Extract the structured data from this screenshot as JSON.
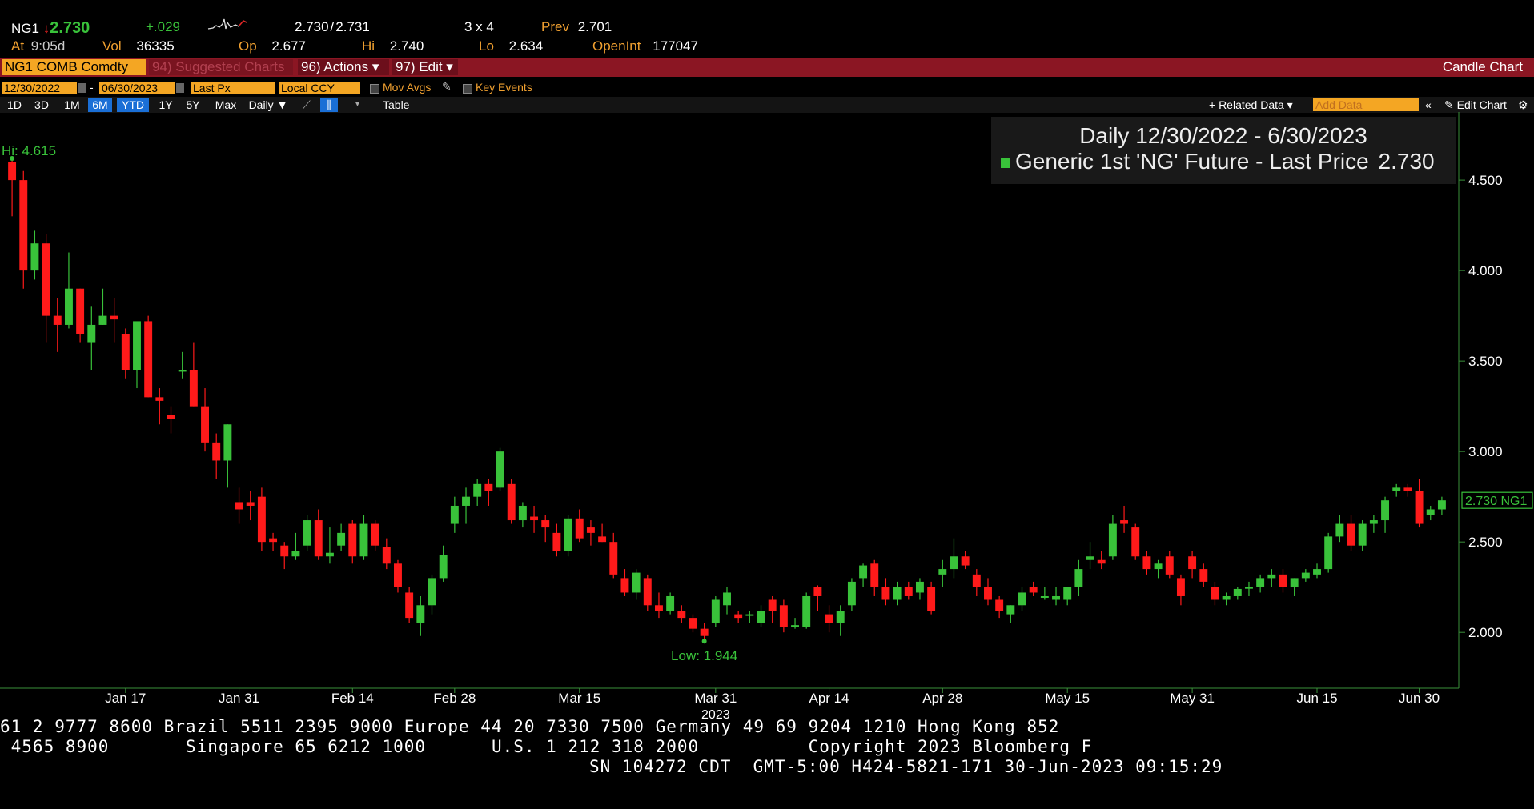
{
  "quote": {
    "ticker": "NG1",
    "arrow": "↓",
    "last": "2.730",
    "change": "+.029",
    "bidask_bid": "2.730",
    "bidask_sep": "/",
    "bidask_ask": "2.731",
    "size": "3 x 4",
    "prev_label": "Prev",
    "prev": "2.701",
    "at_label": "At",
    "at_time": "9:05d",
    "vol_label": "Vol",
    "vol": "36335",
    "op_label": "Op",
    "op": "2.677",
    "hi_label": "Hi",
    "hi": "2.740",
    "lo_label": "Lo",
    "lo": "2.634",
    "openint_label": "OpenInt",
    "openint": "177047"
  },
  "menubar": {
    "security": "NG1 COMB Comdty",
    "suggested": "94) Suggested Charts",
    "actions": "96) Actions ▾",
    "edit": "97) Edit ▾",
    "chart_type": "Candle Chart"
  },
  "options": {
    "start_date": "12/30/2022",
    "dash": "-",
    "end_date": "06/30/2023",
    "field": "Last Px",
    "currency": "Local CCY",
    "mov_avgs": "Mov Avgs",
    "key_events": "Key Events"
  },
  "toolbar": {
    "periods": [
      "1D",
      "3D",
      "1M",
      "6M",
      "YTD",
      "1Y",
      "5Y",
      "Max"
    ],
    "selected": [
      "6M",
      "YTD"
    ],
    "frequency": "Daily ▼",
    "table": "Table",
    "related": "+ Related Data ▾",
    "add_data": "Add Data",
    "edit_chart": "Edit Chart"
  },
  "legend": {
    "title": "Daily 12/30/2022 - 6/30/2023",
    "series": "Generic 1st 'NG' Future - Last Price",
    "series_value": "2.730"
  },
  "colors": {
    "up": "#39c23a",
    "down": "#ff1a1a",
    "axis": "#3a8f3a",
    "menubar": "#8b1623",
    "accent": "#f4a623"
  },
  "chart_data": {
    "type": "candlestick",
    "title": "Daily 12/30/2022 - 6/30/2023",
    "year_label": "2023",
    "ylim": [
      1.7,
      4.85
    ],
    "yticks": [
      "2.000",
      "2.500",
      "3.000",
      "3.500",
      "4.000",
      "4.500"
    ],
    "xticks": [
      {
        "label": "Jan 17",
        "i": 10
      },
      {
        "label": "Jan 31",
        "i": 20
      },
      {
        "label": "Feb 14",
        "i": 30
      },
      {
        "label": "Feb 28",
        "i": 39
      },
      {
        "label": "Mar 15",
        "i": 50
      },
      {
        "label": "Mar 31",
        "i": 62
      },
      {
        "label": "Apr 14",
        "i": 72
      },
      {
        "label": "Apr 28",
        "i": 82
      },
      {
        "label": "May 15",
        "i": 93
      },
      {
        "label": "May 31",
        "i": 104
      },
      {
        "label": "Jun 15",
        "i": 115
      },
      {
        "label": "Jun 30",
        "i": 124
      }
    ],
    "hi_label": "Hi: 4.615",
    "low_label": "Low: 1.944",
    "last_label": "2.730 NG1",
    "last_value": 2.73,
    "candles": [
      [
        4.6,
        4.62,
        4.3,
        4.5
      ],
      [
        4.5,
        4.55,
        3.9,
        4.0
      ],
      [
        4.0,
        4.22,
        3.95,
        4.15
      ],
      [
        4.15,
        4.2,
        3.6,
        3.75
      ],
      [
        3.75,
        3.85,
        3.55,
        3.7
      ],
      [
        3.7,
        4.1,
        3.68,
        3.9
      ],
      [
        3.9,
        3.9,
        3.6,
        3.65
      ],
      [
        3.6,
        3.8,
        3.45,
        3.7
      ],
      [
        3.7,
        3.9,
        3.7,
        3.75
      ],
      [
        3.75,
        3.85,
        3.6,
        3.73
      ],
      [
        3.65,
        3.68,
        3.4,
        3.45
      ],
      [
        3.45,
        3.5,
        3.35,
        3.72
      ],
      [
        3.72,
        3.75,
        3.3,
        3.3
      ],
      [
        3.3,
        3.35,
        3.15,
        3.28
      ],
      [
        3.2,
        3.25,
        3.1,
        3.18
      ],
      [
        3.45,
        3.55,
        3.4,
        3.45
      ],
      [
        3.45,
        3.6,
        3.25,
        3.25
      ],
      [
        3.25,
        3.35,
        3.0,
        3.05
      ],
      [
        3.05,
        3.1,
        2.85,
        2.95
      ],
      [
        2.95,
        3.15,
        2.8,
        3.15
      ],
      [
        2.72,
        2.8,
        2.6,
        2.68
      ],
      [
        2.72,
        2.78,
        2.62,
        2.7
      ],
      [
        2.75,
        2.8,
        2.45,
        2.5
      ],
      [
        2.52,
        2.55,
        2.45,
        2.5
      ],
      [
        2.48,
        2.5,
        2.35,
        2.42
      ],
      [
        2.42,
        2.55,
        2.4,
        2.45
      ],
      [
        2.48,
        2.65,
        2.45,
        2.62
      ],
      [
        2.62,
        2.68,
        2.4,
        2.42
      ],
      [
        2.42,
        2.58,
        2.38,
        2.44
      ],
      [
        2.48,
        2.6,
        2.45,
        2.55
      ],
      [
        2.6,
        2.62,
        2.38,
        2.42
      ],
      [
        2.42,
        2.65,
        2.4,
        2.6
      ],
      [
        2.6,
        2.62,
        2.45,
        2.48
      ],
      [
        2.47,
        2.52,
        2.35,
        2.38
      ],
      [
        2.38,
        2.4,
        2.22,
        2.25
      ],
      [
        2.22,
        2.25,
        2.05,
        2.08
      ],
      [
        2.05,
        2.2,
        1.98,
        2.15
      ],
      [
        2.15,
        2.32,
        2.1,
        2.3
      ],
      [
        2.3,
        2.48,
        2.28,
        2.43
      ],
      [
        2.6,
        2.75,
        2.55,
        2.7
      ],
      [
        2.7,
        2.8,
        2.6,
        2.75
      ],
      [
        2.75,
        2.85,
        2.7,
        2.82
      ],
      [
        2.82,
        2.85,
        2.7,
        2.78
      ],
      [
        2.8,
        3.02,
        2.78,
        3.0
      ],
      [
        2.82,
        2.85,
        2.6,
        2.62
      ],
      [
        2.62,
        2.72,
        2.58,
        2.7
      ],
      [
        2.64,
        2.7,
        2.55,
        2.62
      ],
      [
        2.62,
        2.65,
        2.5,
        2.58
      ],
      [
        2.55,
        2.6,
        2.42,
        2.45
      ],
      [
        2.45,
        2.65,
        2.42,
        2.63
      ],
      [
        2.63,
        2.68,
        2.5,
        2.52
      ],
      [
        2.58,
        2.62,
        2.48,
        2.55
      ],
      [
        2.53,
        2.6,
        2.5,
        2.5
      ],
      [
        2.5,
        2.55,
        2.3,
        2.32
      ],
      [
        2.3,
        2.35,
        2.2,
        2.22
      ],
      [
        2.22,
        2.35,
        2.18,
        2.33
      ],
      [
        2.3,
        2.32,
        2.12,
        2.15
      ],
      [
        2.15,
        2.22,
        2.08,
        2.12
      ],
      [
        2.12,
        2.22,
        2.1,
        2.2
      ],
      [
        2.12,
        2.15,
        2.05,
        2.08
      ],
      [
        2.08,
        2.1,
        2.0,
        2.02
      ],
      [
        2.02,
        2.05,
        1.96,
        1.98
      ],
      [
        2.05,
        2.2,
        2.03,
        2.18
      ],
      [
        2.15,
        2.25,
        2.1,
        2.22
      ],
      [
        2.1,
        2.12,
        2.05,
        2.08
      ],
      [
        2.1,
        2.12,
        2.05,
        2.1
      ],
      [
        2.05,
        2.15,
        2.03,
        2.12
      ],
      [
        2.18,
        2.2,
        2.05,
        2.12
      ],
      [
        2.15,
        2.18,
        2.0,
        2.03
      ],
      [
        2.03,
        2.08,
        2.02,
        2.04
      ],
      [
        2.03,
        2.22,
        2.02,
        2.2
      ],
      [
        2.25,
        2.26,
        2.12,
        2.2
      ],
      [
        2.1,
        2.15,
        2.0,
        2.05
      ],
      [
        2.05,
        2.15,
        1.98,
        2.12
      ],
      [
        2.15,
        2.3,
        2.12,
        2.28
      ],
      [
        2.3,
        2.38,
        2.25,
        2.37
      ],
      [
        2.38,
        2.4,
        2.2,
        2.25
      ],
      [
        2.25,
        2.3,
        2.15,
        2.18
      ],
      [
        2.18,
        2.28,
        2.15,
        2.25
      ],
      [
        2.25,
        2.28,
        2.18,
        2.2
      ],
      [
        2.22,
        2.3,
        2.18,
        2.28
      ],
      [
        2.25,
        2.28,
        2.1,
        2.12
      ],
      [
        2.32,
        2.4,
        2.25,
        2.35
      ],
      [
        2.35,
        2.52,
        2.3,
        2.42
      ],
      [
        2.42,
        2.45,
        2.35,
        2.37
      ],
      [
        2.32,
        2.35,
        2.2,
        2.25
      ],
      [
        2.25,
        2.3,
        2.15,
        2.18
      ],
      [
        2.18,
        2.2,
        2.08,
        2.12
      ],
      [
        2.1,
        2.15,
        2.05,
        2.15
      ],
      [
        2.15,
        2.25,
        2.12,
        2.22
      ],
      [
        2.25,
        2.28,
        2.2,
        2.22
      ],
      [
        2.2,
        2.25,
        2.18,
        2.2
      ],
      [
        2.18,
        2.25,
        2.15,
        2.2
      ],
      [
        2.18,
        2.25,
        2.15,
        2.25
      ],
      [
        2.25,
        2.4,
        2.2,
        2.35
      ],
      [
        2.4,
        2.5,
        2.35,
        2.42
      ],
      [
        2.4,
        2.45,
        2.35,
        2.38
      ],
      [
        2.42,
        2.65,
        2.4,
        2.6
      ],
      [
        2.62,
        2.7,
        2.55,
        2.6
      ],
      [
        2.58,
        2.6,
        2.4,
        2.42
      ],
      [
        2.42,
        2.45,
        2.32,
        2.35
      ],
      [
        2.35,
        2.4,
        2.3,
        2.38
      ],
      [
        2.42,
        2.45,
        2.3,
        2.32
      ],
      [
        2.3,
        2.32,
        2.15,
        2.2
      ],
      [
        2.42,
        2.45,
        2.3,
        2.35
      ],
      [
        2.35,
        2.38,
        2.25,
        2.28
      ],
      [
        2.25,
        2.28,
        2.15,
        2.18
      ],
      [
        2.18,
        2.22,
        2.15,
        2.2
      ],
      [
        2.2,
        2.25,
        2.18,
        2.24
      ],
      [
        2.25,
        2.28,
        2.2,
        2.25
      ],
      [
        2.25,
        2.32,
        2.22,
        2.3
      ],
      [
        2.3,
        2.35,
        2.25,
        2.32
      ],
      [
        2.32,
        2.35,
        2.22,
        2.25
      ],
      [
        2.25,
        2.3,
        2.2,
        2.3
      ],
      [
        2.3,
        2.35,
        2.28,
        2.33
      ],
      [
        2.32,
        2.38,
        2.3,
        2.35
      ],
      [
        2.35,
        2.55,
        2.33,
        2.53
      ],
      [
        2.53,
        2.65,
        2.5,
        2.6
      ],
      [
        2.6,
        2.65,
        2.45,
        2.48
      ],
      [
        2.48,
        2.62,
        2.45,
        2.6
      ],
      [
        2.6,
        2.65,
        2.55,
        2.62
      ],
      [
        2.62,
        2.75,
        2.55,
        2.73
      ],
      [
        2.78,
        2.82,
        2.75,
        2.8
      ],
      [
        2.8,
        2.82,
        2.75,
        2.78
      ],
      [
        2.78,
        2.85,
        2.58,
        2.6
      ],
      [
        2.65,
        2.7,
        2.62,
        2.68
      ],
      [
        2.68,
        2.75,
        2.65,
        2.73
      ]
    ]
  },
  "footer": {
    "line1": "61 2 9777 8600 Brazil 5511 2395 9000 Europe 44 20 7330 7500 Germany 49 69 9204 1210 Hong Kong 852",
    "line2": " 4565 8900       Singapore 65 6212 1000      U.S. 1 212 318 2000          Copyright 2023 Bloomberg F",
    "line3": "SN 104272 CDT  GMT-5:00 H424-5821-171 30-Jun-2023 09:15:29"
  }
}
